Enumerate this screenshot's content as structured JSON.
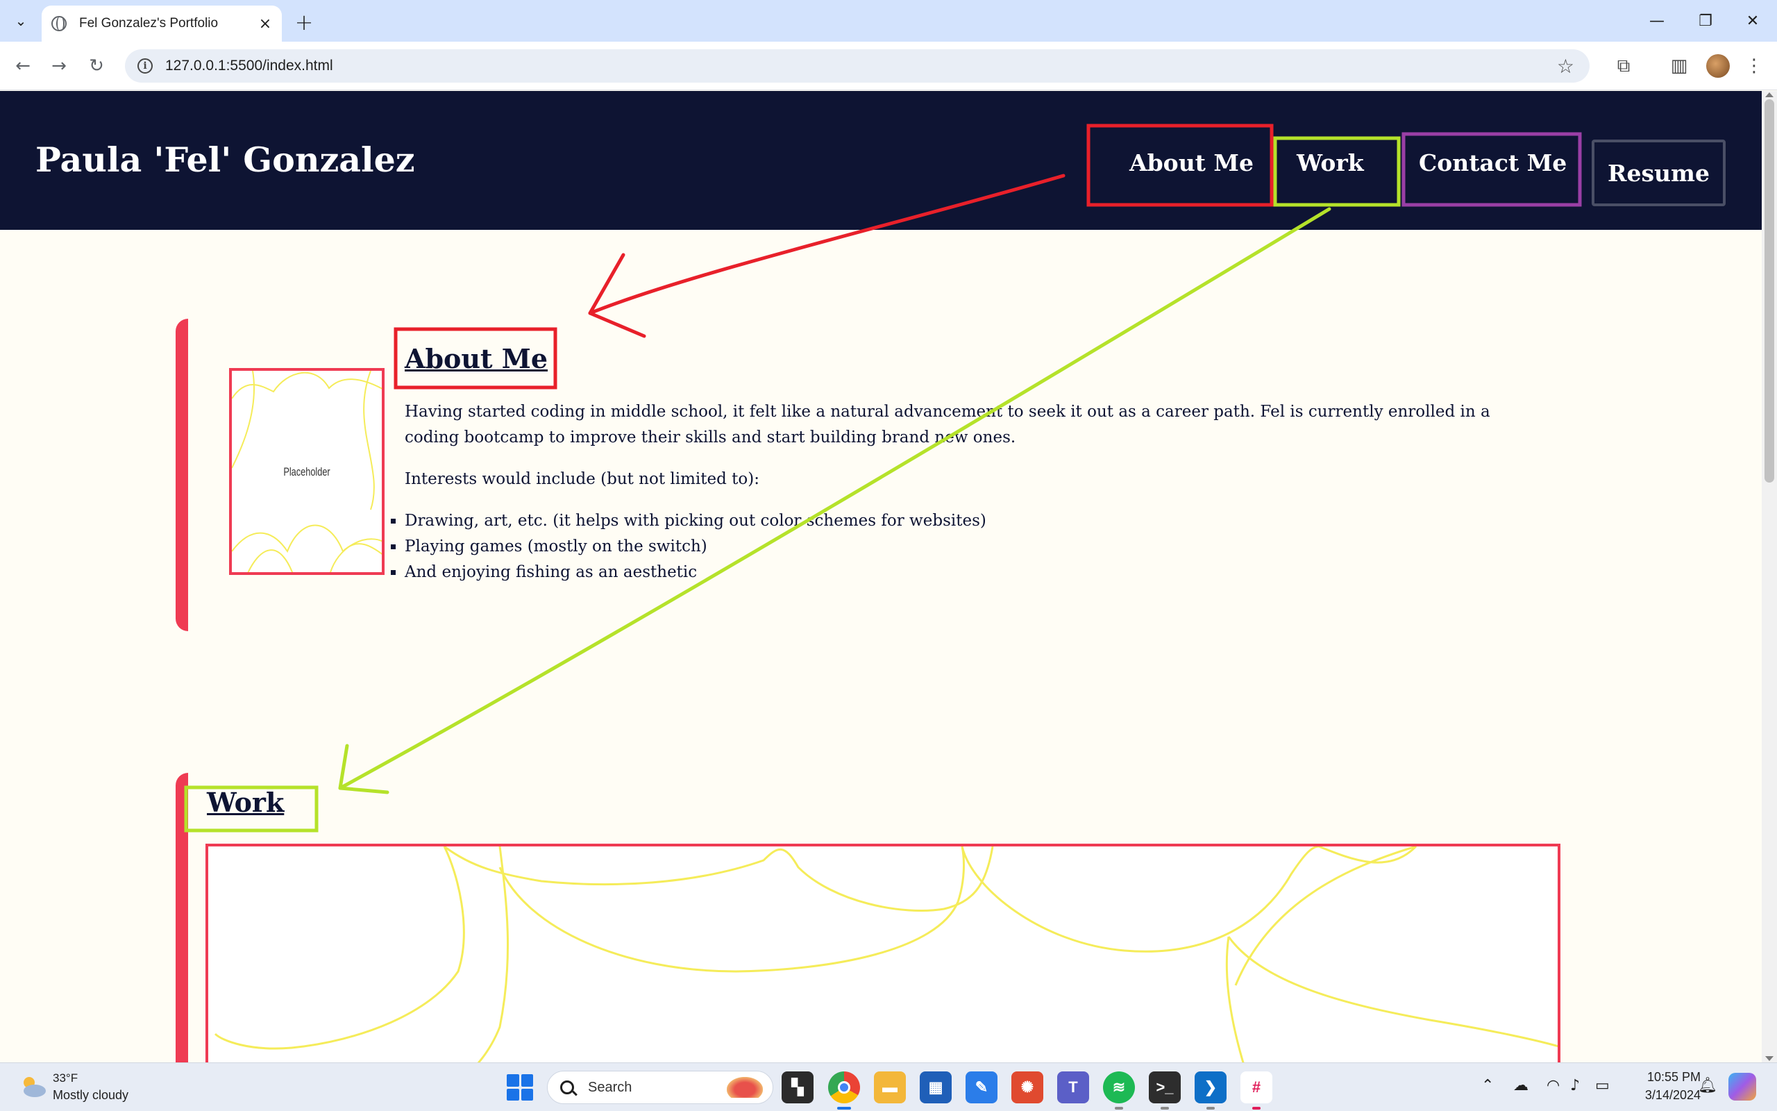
{
  "browser": {
    "tab_title": "Fel Gonzalez's Portfolio",
    "new_tab_glyph": "+",
    "close_glyph": "×",
    "url": "127.0.0.1:5500/index.html"
  },
  "site": {
    "name": "Paula 'Fel' Gonzalez",
    "nav": {
      "about": "About Me",
      "work": "Work",
      "contact": "Contact Me",
      "resume": "Resume"
    }
  },
  "about": {
    "heading": "About Me",
    "image_label": "Placeholder",
    "paragraph": "Having started coding in middle school, it felt like a natural advancement to seek it out as a career path. Fel is currently enrolled in a coding bootcamp to improve their skills and start building brand new ones.",
    "interests_intro": "Interests would include (but not limited to):",
    "interests": [
      "Drawing, art, etc. (it helps with picking out color schemes for websites)",
      "Playing games (mostly on the switch)",
      "And enjoying fishing as an aesthetic"
    ]
  },
  "work": {
    "heading": "Work"
  },
  "annotations": {
    "colors": {
      "about": "#e8202a",
      "work": "#b5e22a",
      "contact": "#9a3fa6"
    }
  },
  "taskbar": {
    "weather_temp": "33°F",
    "weather_desc": "Mostly cloudy",
    "search_placeholder": "Search",
    "time": "10:55 PM",
    "date": "3/14/2024"
  },
  "icons": [
    "tab-search-icon",
    "globe-icon",
    "back-icon",
    "forward-icon",
    "reload-icon",
    "info-icon",
    "star-icon",
    "extensions-icon",
    "side-panel-icon",
    "menu-icon",
    "windows-start-icon",
    "search-icon",
    "chrome-icon",
    "file-explorer-icon",
    "store-icon",
    "vscode-icon",
    "spotify-icon",
    "terminal-icon",
    "slack-icon",
    "teams-icon",
    "wifi-icon",
    "volume-icon",
    "battery-icon",
    "bell-icon"
  ]
}
